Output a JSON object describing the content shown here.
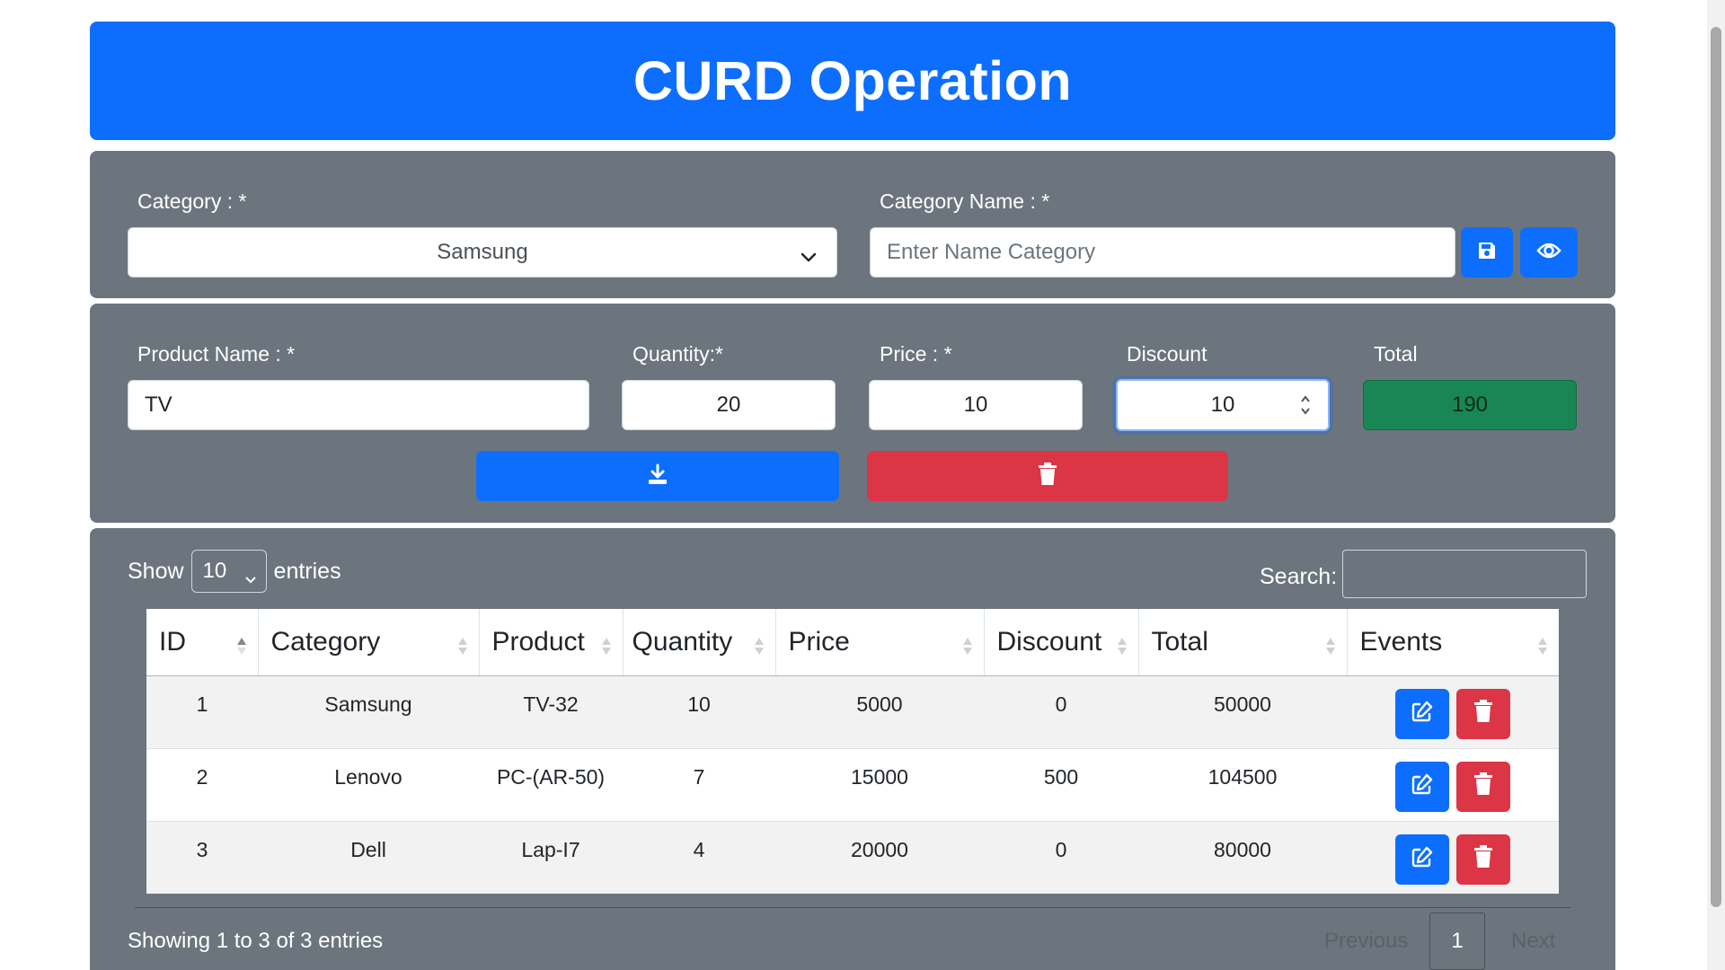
{
  "header": {
    "title": "CURD Operation"
  },
  "category_form": {
    "category_label": "Category : *",
    "category_selected": "Samsung",
    "category_name_label": "Category Name : *",
    "category_name_placeholder": "Enter Name Category",
    "save_icon": "floppy-disk-icon",
    "view_icon": "eye-icon"
  },
  "product_form": {
    "product_name_label": "Product Name : *",
    "product_name_value": "TV",
    "quantity_label": "Quantity:*",
    "quantity_value": "20",
    "price_label": "Price : *",
    "price_value": "10",
    "discount_label": "Discount",
    "discount_value": "10",
    "total_label": "Total",
    "total_value": "190",
    "save_icon": "download-icon",
    "delete_icon": "trash-icon"
  },
  "table_controls": {
    "show_label": "Show",
    "show_value": "10",
    "entries_label": "entries",
    "search_label": "Search:"
  },
  "table": {
    "columns": [
      "ID",
      "Category",
      "Product",
      "Quantity",
      "Price",
      "Discount",
      "Total",
      "Events"
    ],
    "rows": [
      {
        "id": "1",
        "category": "Samsung",
        "product": "TV-32",
        "quantity": "10",
        "price": "5000",
        "discount": "0",
        "total": "50000"
      },
      {
        "id": "2",
        "category": "Lenovo",
        "product": "PC-(AR-50)",
        "quantity": "7",
        "price": "15000",
        "discount": "500",
        "total": "104500"
      },
      {
        "id": "3",
        "category": "Dell",
        "product": "Lap-I7",
        "quantity": "4",
        "price": "20000",
        "discount": "0",
        "total": "80000"
      }
    ]
  },
  "footer": {
    "info": "Showing 1 to 3 of 3 entries",
    "previous": "Previous",
    "current_page": "1",
    "next": "Next"
  },
  "colors": {
    "primary": "#0d6efd",
    "danger": "#dc3545",
    "success": "#198754",
    "panel": "#6c757d"
  }
}
